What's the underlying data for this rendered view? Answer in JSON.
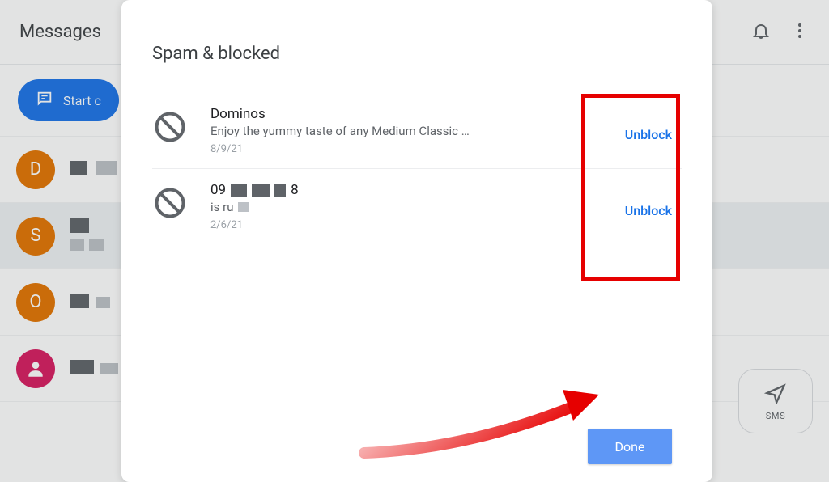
{
  "header": {
    "title": "Messages",
    "start_chat_label": "Start c"
  },
  "conversations": [
    {
      "initial": "D"
    },
    {
      "initial": "S"
    },
    {
      "initial": "O"
    },
    {
      "initial": ""
    }
  ],
  "sms_fab_label": "SMS",
  "dialog": {
    "title": "Spam & blocked",
    "done_label": "Done",
    "items": [
      {
        "name": "Dominos",
        "preview": "Enjoy the yummy taste of any Medium Classic …",
        "date": "8/9/21",
        "action": "Unblock"
      },
      {
        "name_prefix": "09",
        "name_suffix": "8",
        "preview_prefix": "is ru",
        "date": "2/6/21",
        "action": "Unblock"
      }
    ]
  }
}
